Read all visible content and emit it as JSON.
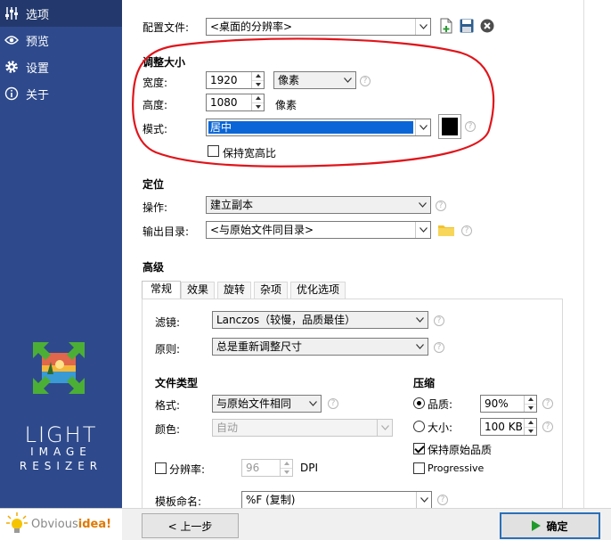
{
  "sidebar": {
    "items": [
      {
        "label": "选项",
        "icon": "sliders-icon",
        "active": true
      },
      {
        "label": "预览",
        "icon": "eye-icon",
        "active": false
      },
      {
        "label": "设置",
        "icon": "gear-icon",
        "active": false
      },
      {
        "label": "关于",
        "icon": "info-icon",
        "active": false
      }
    ],
    "brand": {
      "line1": "LIGHT",
      "line2": "IMAGE",
      "line3": "RESIZER"
    },
    "footer": {
      "prefix": "Obvious",
      "suffix": "idea!"
    }
  },
  "profile": {
    "label": "配置文件:",
    "value": "<桌面的分辨率>",
    "icons": [
      "new-profile-icon",
      "save-icon",
      "delete-icon"
    ]
  },
  "resize": {
    "title": "调整大小",
    "width_label": "宽度:",
    "width_value": "1920",
    "unit_value": "像素",
    "height_label": "高度:",
    "height_value": "1080",
    "height_unit": "像素",
    "mode_label": "模式:",
    "mode_value": "居中",
    "background_color": "#000000",
    "keep_ratio_label": "保持宽高比",
    "keep_ratio_checked": false
  },
  "position": {
    "title": "定位",
    "action_label": "操作:",
    "action_value": "建立副本",
    "output_label": "输出目录:",
    "output_value": "<与原始文件同目录>"
  },
  "advanced": {
    "title": "高级",
    "tabs": [
      "常规",
      "效果",
      "旋转",
      "杂项",
      "优化选项"
    ],
    "active_tab": "常规",
    "filter_label": "滤镜:",
    "filter_value": "Lanczos（较慢，品质最佳）",
    "rule_label": "原则:",
    "rule_value": "总是重新调整尺寸",
    "filetype_title": "文件类型",
    "format_label": "格式:",
    "format_value": "与原始文件相同",
    "color_label": "颜色:",
    "color_value": "自动",
    "compression_title": "压缩",
    "quality_label": "品质:",
    "quality_value": "90%",
    "quality_selected": true,
    "size_label": "大小:",
    "size_value": "100 KB",
    "keep_quality_label": "保持原始品质",
    "keep_quality_checked": true,
    "progressive_label": "Progressive",
    "progressive_checked": false,
    "resolution_label": "分辨率:",
    "resolution_value": "96",
    "resolution_unit": "DPI",
    "resolution_checked": false,
    "template_label": "模板命名:",
    "template_value": "%F (复制)"
  },
  "footer": {
    "back_label": "< 上一步",
    "ok_label": "确定",
    "accent": "#2a6fb8"
  },
  "annotation": {
    "color": "#e0151b"
  }
}
